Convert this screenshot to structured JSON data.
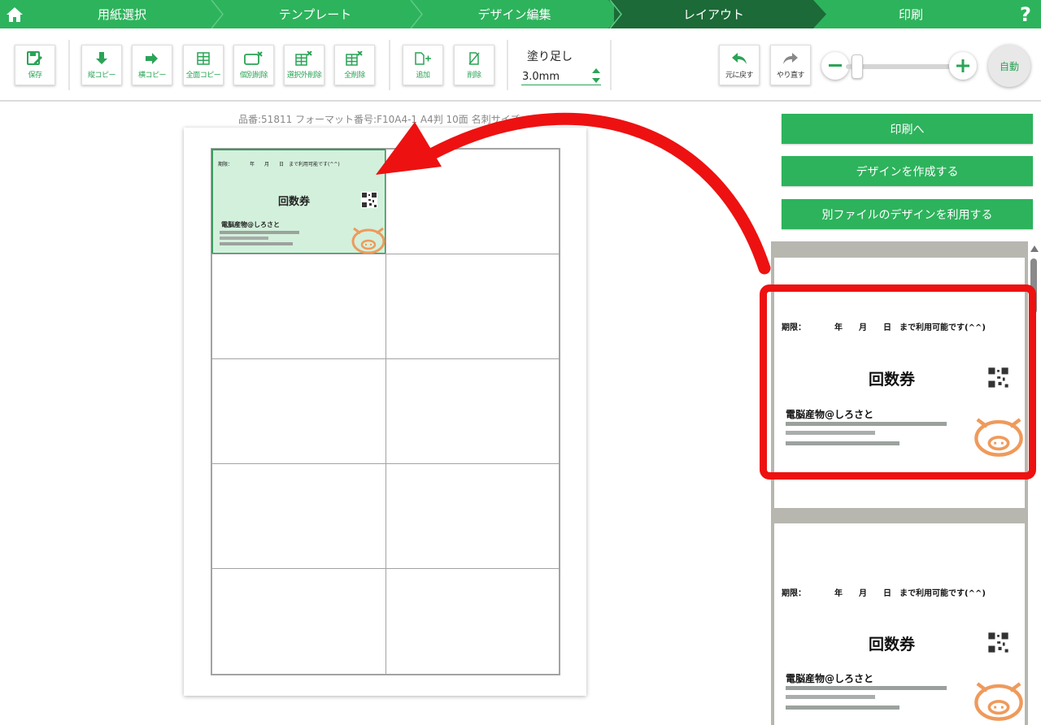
{
  "steps": [
    {
      "label": "用紙選択",
      "active": false
    },
    {
      "label": "テンプレート",
      "active": false
    },
    {
      "label": "デザイン編集",
      "active": false
    },
    {
      "label": "レイアウト",
      "active": true
    },
    {
      "label": "印刷",
      "active": false
    }
  ],
  "help_label": "?",
  "toolbar": {
    "save": "保存",
    "vertical_copy": "縦コピー",
    "horizontal_copy": "横コピー",
    "all_copy": "全面コピー",
    "individual_delete": "個別削除",
    "delete_unselected": "選択外削除",
    "delete_all": "全削除",
    "add": "追加",
    "delete": "削除",
    "bleed_label": "塗り足し",
    "bleed_value": "3.0mm",
    "undo": "元に戻す",
    "redo": "やり直す",
    "zoom_auto": "自動"
  },
  "zoom": {
    "level": 0.05
  },
  "product_info": "品番:51811 フォーマット番号:F10A4-1 A4判 10面 名刺サイズ",
  "card": {
    "period": "期限：　　　　年　　月　　日　まで利用可能です(^^)",
    "title": "回数券",
    "company": "電脳産物@しろさと"
  },
  "right_panel": {
    "print_button": "印刷へ",
    "create_design_button": "デザインを作成する",
    "use_other_file_button": "別ファイルのデザインを利用する"
  },
  "colors": {
    "brand_green": "#2db35c",
    "active_step": "#1b6a37",
    "annotation_red": "#ee1111",
    "selected_cell": "#d3f0dc"
  }
}
